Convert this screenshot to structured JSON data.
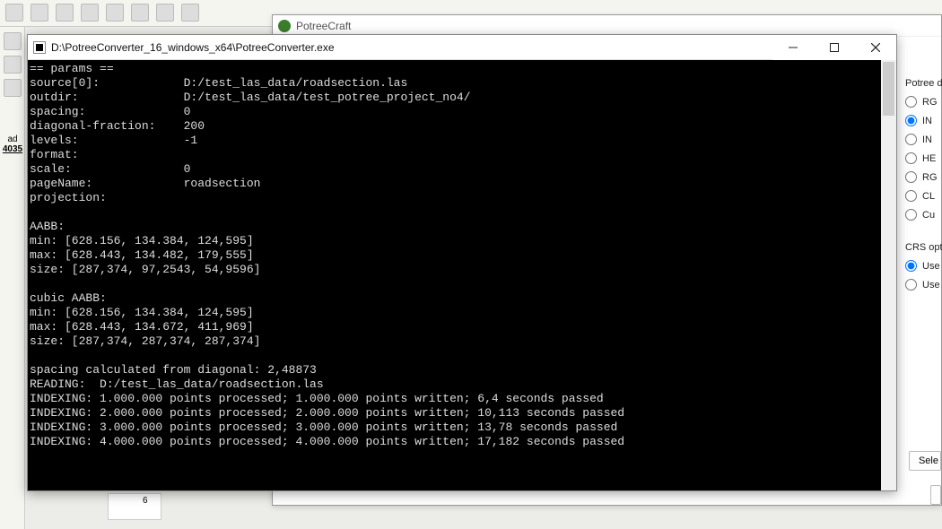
{
  "mainApp": {
    "sideLabel": "ad",
    "sideNum": "4035",
    "rulerVal": "6"
  },
  "potreecraft": {
    "title": "PotreeCraft"
  },
  "panel": {
    "group1": "Potree de",
    "opts1": [
      "RG",
      "IN",
      "IN",
      "HE",
      "RG",
      "CL",
      "Cu"
    ],
    "selectedIdx1": 1,
    "group2": "CRS optio",
    "opts2": [
      "Use",
      "Use"
    ],
    "selectedIdx2": 0,
    "selectBtn": "Sele"
  },
  "console": {
    "title": "D:\\PotreeConverter_16_windows_x64\\PotreeConverter.exe",
    "lines": [
      "== params ==",
      "source[0]:            D:/test_las_data/roadsection.las",
      "outdir:               D:/test_las_data/test_potree_project_no4/",
      "spacing:              0",
      "diagonal-fraction:    200",
      "levels:               -1",
      "format:               ",
      "scale:                0",
      "pageName:             roadsection",
      "projection:           ",
      "",
      "AABB: ",
      "min: [628.156, 134.384, 124,595]",
      "max: [628.443, 134.482, 179,555]",
      "size: [287,374, 97,2543, 54,9596]",
      "",
      "cubic AABB: ",
      "min: [628.156, 134.384, 124,595]",
      "max: [628.443, 134.672, 411,969]",
      "size: [287,374, 287,374, 287,374]",
      "",
      "spacing calculated from diagonal: 2,48873",
      "READING:  D:/test_las_data/roadsection.las",
      "INDEXING: 1.000.000 points processed; 1.000.000 points written; 6,4 seconds passed",
      "INDEXING: 2.000.000 points processed; 2.000.000 points written; 10,113 seconds passed",
      "INDEXING: 3.000.000 points processed; 3.000.000 points written; 13,78 seconds passed",
      "INDEXING: 4.000.000 points processed; 4.000.000 points written; 17,182 seconds passed"
    ]
  }
}
